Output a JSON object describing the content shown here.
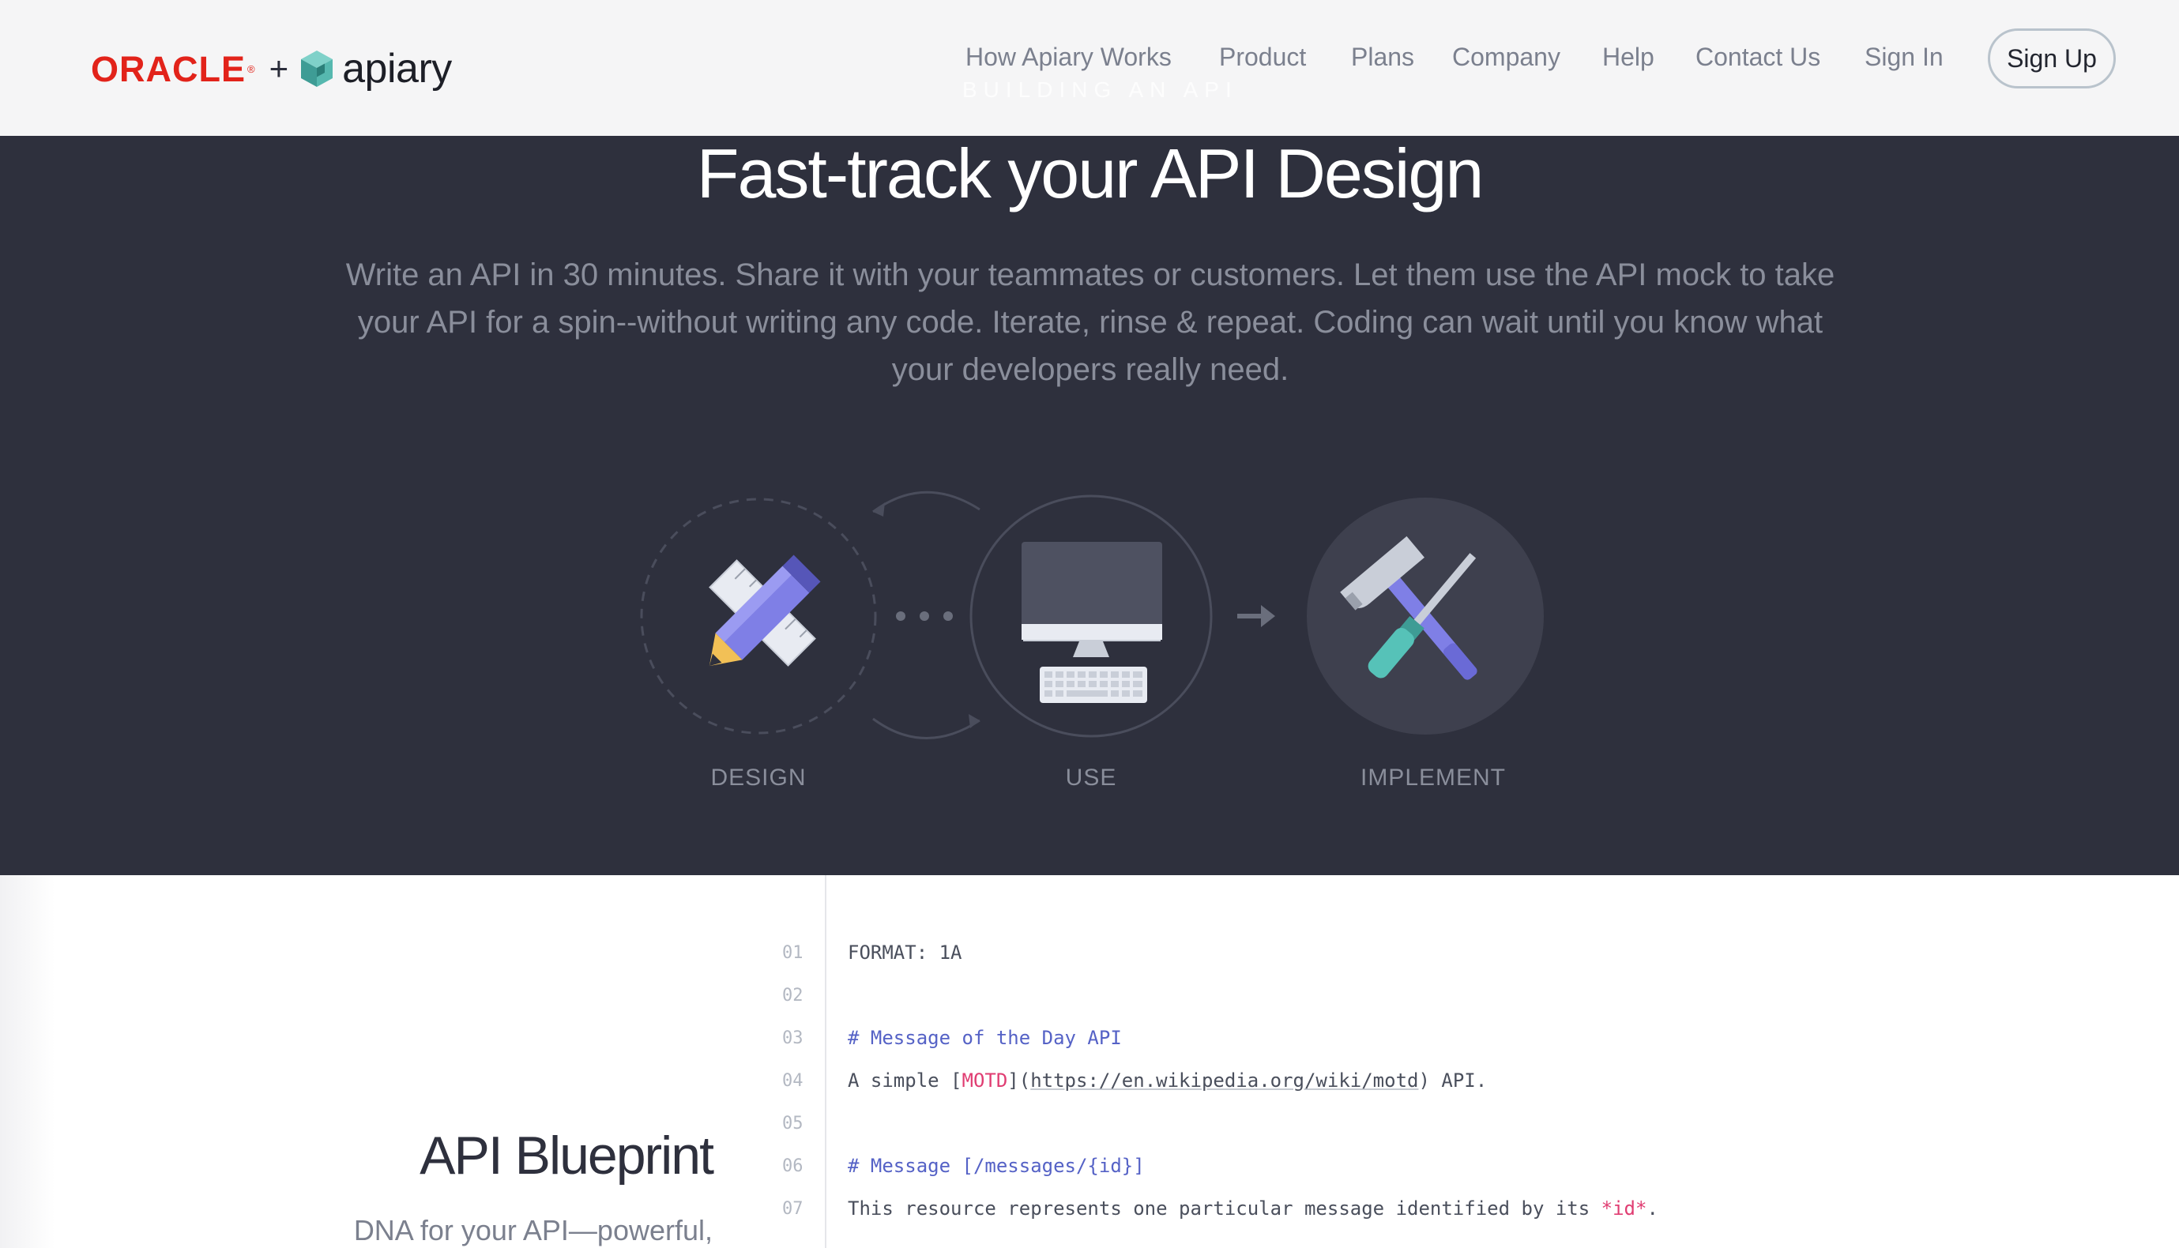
{
  "header": {
    "logo": {
      "oracle": "ORACLE",
      "registered": "®",
      "plus": "+",
      "apiary": "apiary"
    },
    "nav": [
      "How Apiary Works",
      "Product",
      "Plans",
      "Company",
      "Help",
      "Contact Us",
      "Sign In"
    ],
    "signup_label": "Sign Up",
    "ghost_text": "BUILDING AN API"
  },
  "hero": {
    "title": "Fast-track your API Design",
    "subtitle": "Write an API in 30 minutes. Share it with your teammates or customers. Let them use the API mock to take your API for a spin--without writing any code. Iterate, rinse & repeat. Coding can wait until you know what your developers really need.",
    "steps": [
      "DESIGN",
      "USE",
      "IMPLEMENT"
    ]
  },
  "blueprint": {
    "title": "API Blueprint",
    "description": "DNA for your API—powerful,",
    "line_numbers": [
      "01",
      "02",
      "03",
      "04",
      "05",
      "06",
      "07"
    ],
    "code": {
      "l1": "FORMAT: 1A",
      "l3": "# Message of the Day API",
      "l4_a": "A simple [",
      "l4_b": "MOTD",
      "l4_c": "](",
      "l4_d": "https://en.wikipedia.org/wiki/motd",
      "l4_e": ") API.",
      "l6": "# Message [/messages/{id}]",
      "l7_a": "This resource represents one particular message identified by its ",
      "l7_b": "*id*",
      "l7_c": "."
    }
  },
  "colors": {
    "hero_bg": "#2e303d",
    "oracle_red": "#e2231a",
    "accent_blue": "#5562c6",
    "accent_pink": "#e03d72"
  }
}
